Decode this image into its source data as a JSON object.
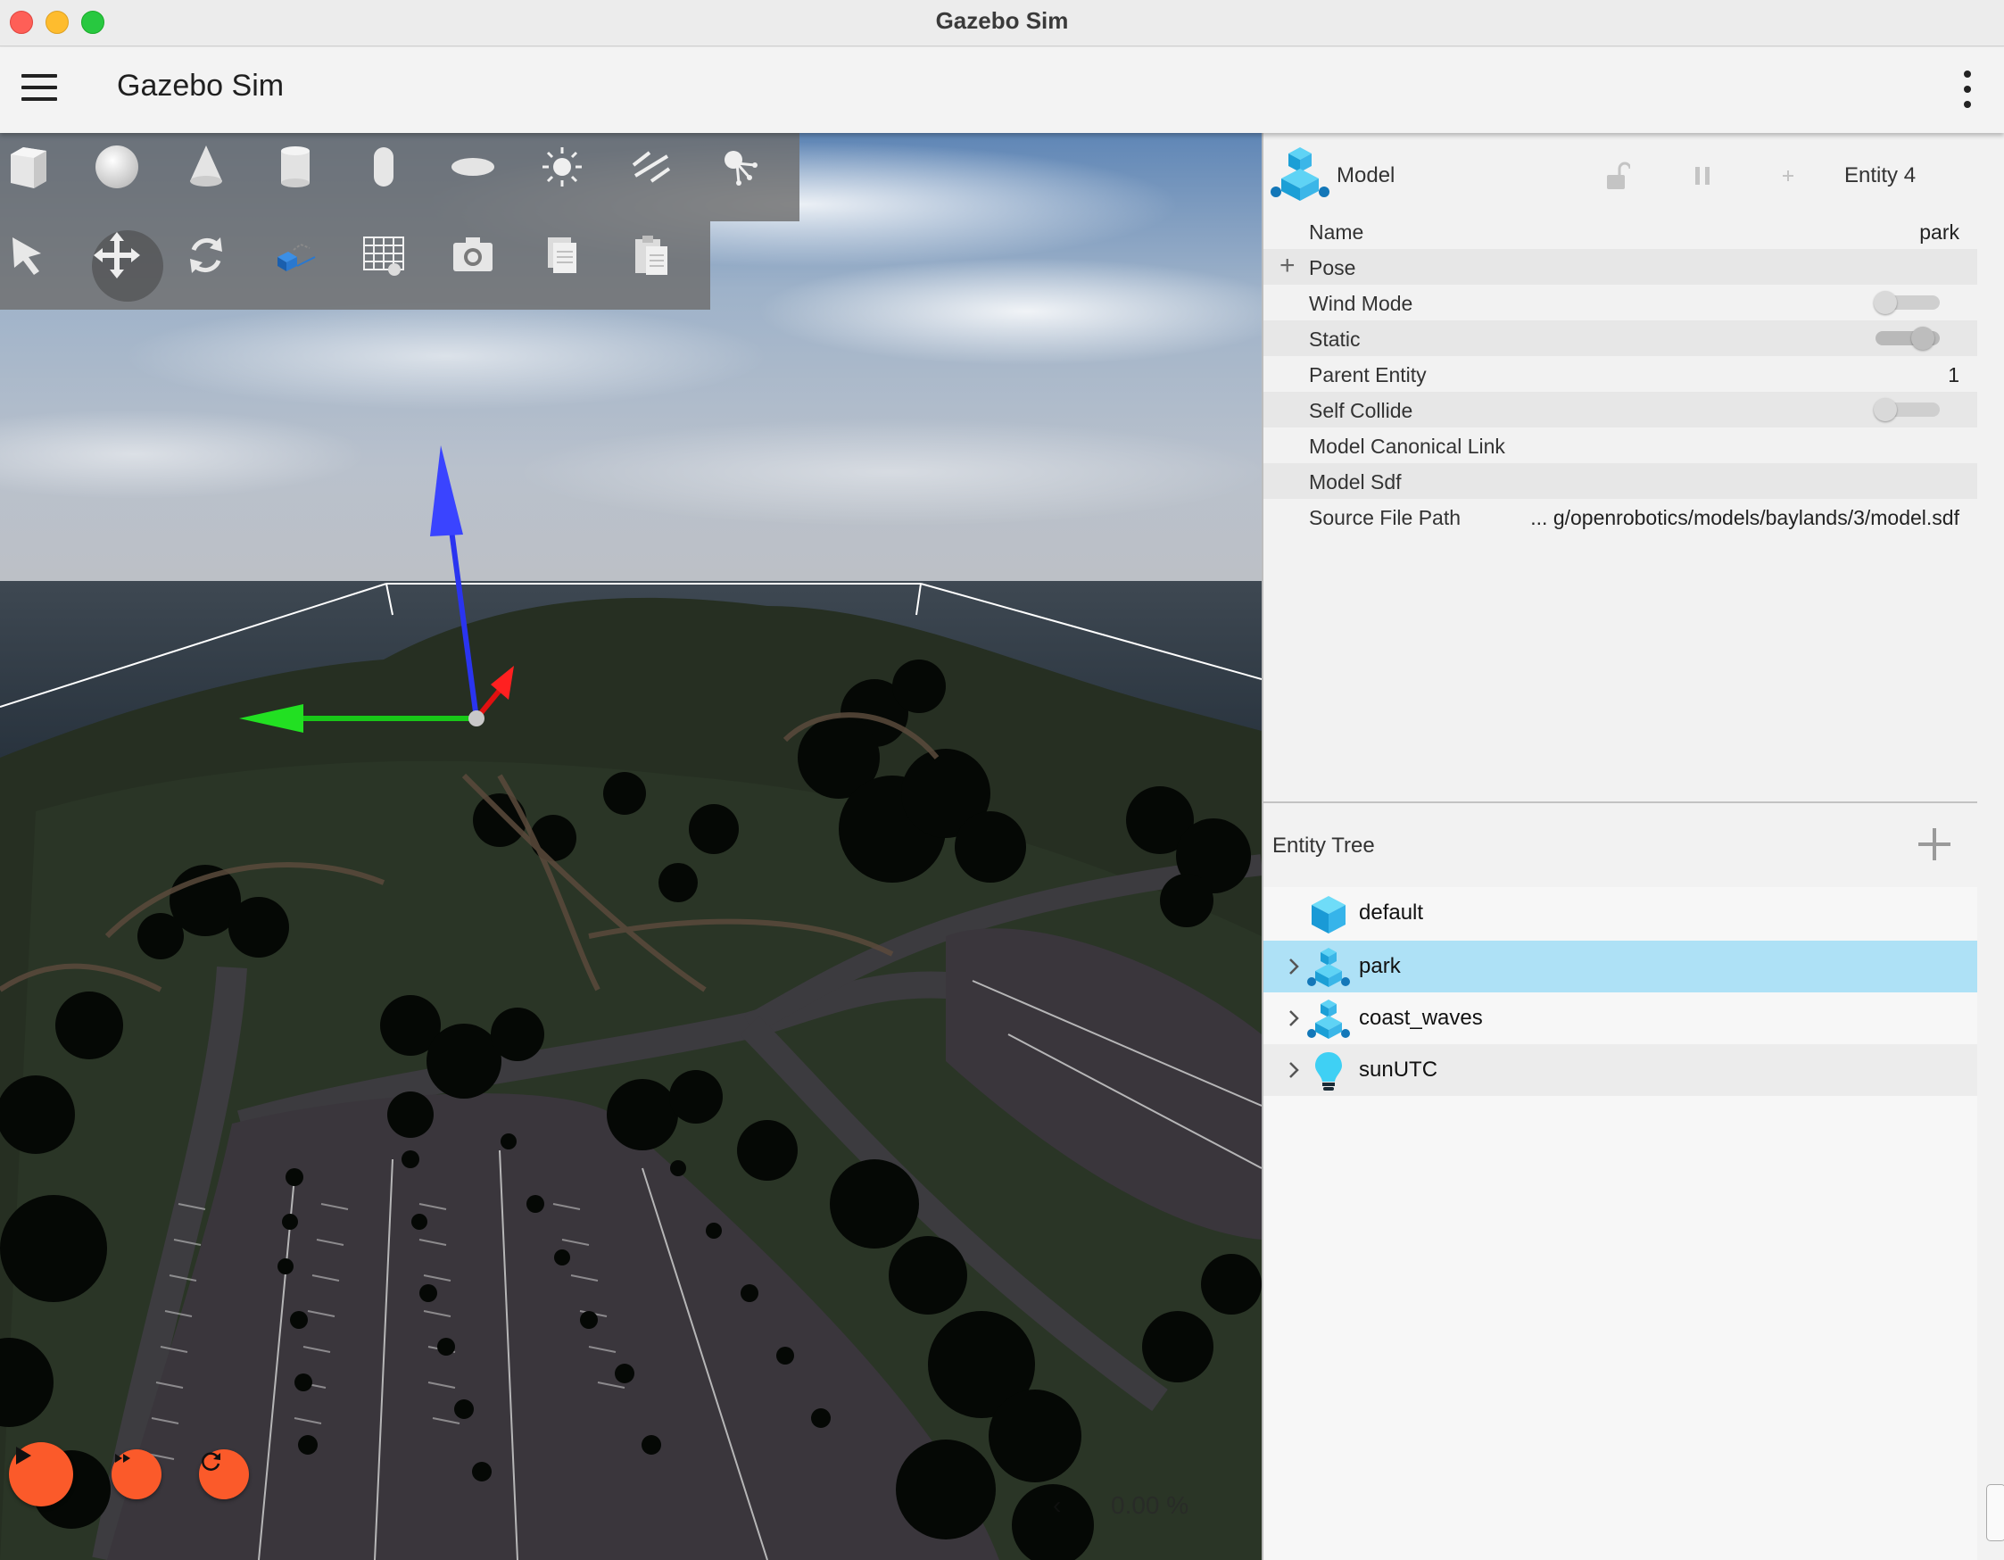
{
  "window": {
    "title": "Gazebo Sim"
  },
  "app": {
    "title": "Gazebo Sim"
  },
  "toolbar": {
    "shapes": [
      "box-icon",
      "sphere-icon",
      "cone-icon",
      "cylinder-icon",
      "capsule-icon",
      "ellipsoid-icon",
      "sun-icon",
      "spot-light-icon",
      "point-light-icon"
    ],
    "transform": [
      "select-arrow-icon",
      "translate-icon",
      "rotate-icon",
      "view-angle-icon",
      "grid-config-icon",
      "screenshot-icon",
      "copy-icon",
      "paste-icon"
    ],
    "active": "translate-icon"
  },
  "playback": {
    "real_time_factor": "0.00 %"
  },
  "component_inspector": {
    "type": "Model",
    "entity": "Entity 4",
    "rows": [
      {
        "label": "Name",
        "value": "park",
        "kind": "text"
      },
      {
        "label": "Pose",
        "value": "",
        "kind": "expand"
      },
      {
        "label": "Wind Mode",
        "value": "off",
        "kind": "toggle"
      },
      {
        "label": "Static",
        "value": "on",
        "kind": "toggle"
      },
      {
        "label": "Parent Entity",
        "value": "1",
        "kind": "text"
      },
      {
        "label": "Self Collide",
        "value": "off",
        "kind": "toggle"
      },
      {
        "label": "Model Canonical Link",
        "value": "",
        "kind": "text"
      },
      {
        "label": "Model Sdf",
        "value": "",
        "kind": "text"
      },
      {
        "label": "Source File Path",
        "value": "... g/openrobotics/models/baylands/3/model.sdf",
        "kind": "text"
      }
    ]
  },
  "entity_tree": {
    "title": "Entity Tree",
    "items": [
      {
        "label": "default",
        "icon": "world-cube-icon",
        "expandable": false,
        "selected": false
      },
      {
        "label": "park",
        "icon": "model-icon",
        "expandable": true,
        "selected": true
      },
      {
        "label": "coast_waves",
        "icon": "model-icon",
        "expandable": true,
        "selected": false
      },
      {
        "label": "sunUTC",
        "icon": "light-bulb-icon",
        "expandable": true,
        "selected": false
      }
    ]
  },
  "colors": {
    "accent": "#fb5a2a",
    "selection": "#aee1f6",
    "x_axis": "#e01010",
    "y_axis": "#18d018",
    "z_axis": "#2a34f0"
  }
}
